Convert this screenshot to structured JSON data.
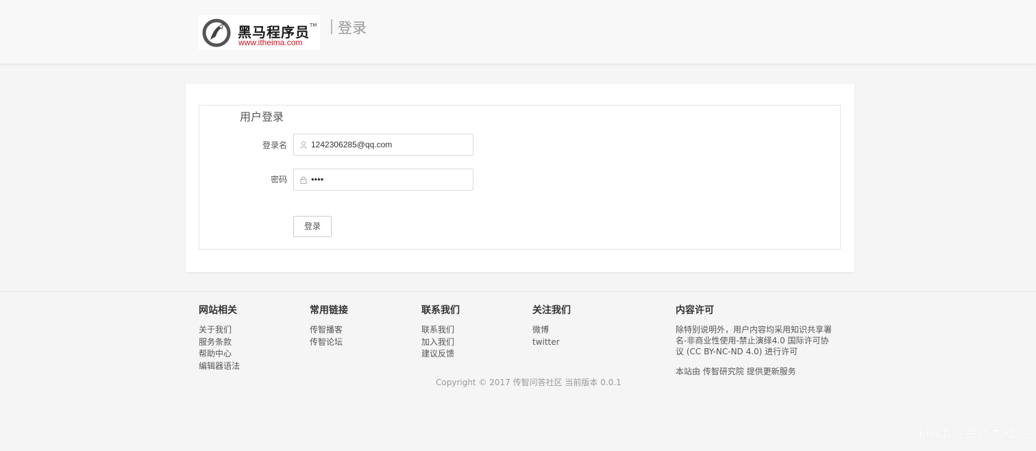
{
  "header": {
    "logo_cn": "黑马程序员",
    "logo_tm": "TM",
    "logo_url": "www.itheima.com",
    "title": "登录"
  },
  "form": {
    "legend": "用户登录",
    "username_label": "登录名",
    "username_value": "1242306285@qq.com",
    "password_label": "密码",
    "password_value": "••••",
    "submit_label": "登录"
  },
  "footer": {
    "columns": [
      {
        "title": "网站相关",
        "links": [
          "关于我们",
          "服务条款",
          "帮助中心",
          "编辑器语法"
        ]
      },
      {
        "title": "常用链接",
        "links": [
          "传智播客",
          "传智论坛"
        ]
      },
      {
        "title": "联系我们",
        "links": [
          "联系我们",
          "加入我们",
          "建议反馈"
        ]
      },
      {
        "title": "关注我们",
        "links": [
          "微博",
          "twitter"
        ]
      }
    ],
    "license": {
      "title": "内容许可",
      "text": "除特别说明外，用户内容均采用知识共享署名-非商业性使用-禁止演绎4.0 国际许可协议 (CC BY-NC-ND 4.0) 进行许可",
      "by": "本站由 传智研究院 提供更新服务"
    },
    "copyright": "Copyright © 2017 传智问答社区 当前版本 0.0.1"
  },
  "watermark": "@稀土掘金技术社区",
  "colors": {
    "brand_red": "#c8161d",
    "background": "#f5f5f5"
  }
}
